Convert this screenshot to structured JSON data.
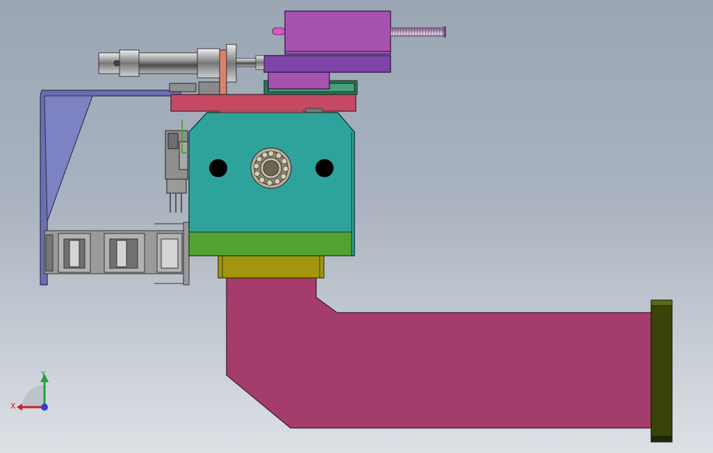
{
  "viewport": {
    "background_top": "#9aa6b4",
    "background_bottom": "#dde1e6"
  },
  "parts": {
    "arm_color": "#a43d6b",
    "end_plate_color": "#394409",
    "housing_color": "#2ea39b",
    "housing_base_color": "#53a334",
    "flange_color": "#a3950e",
    "top_plate_color": "#c44a63",
    "cylinder_block_color": "#a653b0",
    "bracket_color": "#6a6fb0",
    "chain_color": "#8a8a8a"
  },
  "triad": {
    "x_label": "X",
    "y_label": "Y",
    "x_color": "#d11f1f",
    "y_color": "#1ea43a",
    "z_color": "#2c3fd6"
  }
}
